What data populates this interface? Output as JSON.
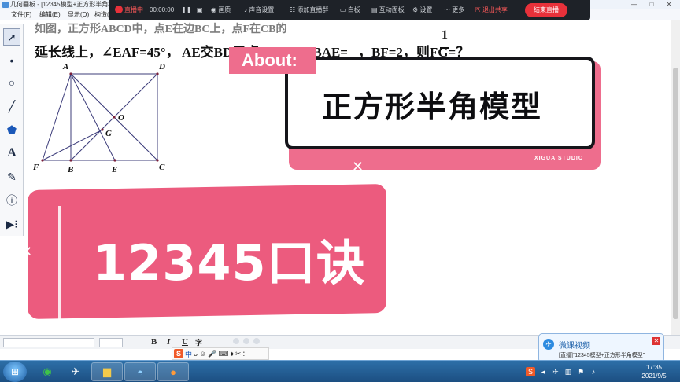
{
  "window": {
    "title": "几何画板 - [12345模型+正方形半角模",
    "controls": [
      "—",
      "□",
      "✕"
    ]
  },
  "menu": {
    "items": [
      "文件(F)",
      "编辑(E)",
      "显示(D)",
      "构造("
    ]
  },
  "livebar": {
    "status": "直播中",
    "timer": "00:00:00",
    "buttons": [
      "画质",
      "声音设置",
      "添加直播群",
      "白板",
      "互动面板",
      "设置",
      "更多"
    ],
    "share": "退出共享",
    "end": "结束直播"
  },
  "toolbox": {
    "tools": [
      "arrow-select",
      "point",
      "circle",
      "line",
      "polygon",
      "text",
      "marker",
      "info",
      "custom"
    ]
  },
  "problem": {
    "line1": "延长线上，∠EAF=45°，  AE交BD于点G，tan∠BAE=",
    "frac_num": "1",
    "line1b": "，BF=2，则FG=？",
    "top_partial": "如图，正方形ABCD中，点E在边BC上，点F在CB的"
  },
  "figure": {
    "labels": [
      "A",
      "D",
      "O",
      "G",
      "F",
      "B",
      "E",
      "C"
    ]
  },
  "about_card": {
    "tag": "About:",
    "title": "正方形半角模型",
    "studio": "XIGUA STUDIO"
  },
  "mnemonic": {
    "text": "12345口诀"
  },
  "formatbar": {
    "buttons": [
      "B",
      "I",
      "U",
      "字"
    ]
  },
  "notification": {
    "title": "微课视频",
    "body": "[直播]“12345模型+正方形半角模型”",
    "close": "✕"
  },
  "ime": {
    "logo": "S",
    "mode": "中"
  },
  "taskbar": {
    "clock_time": "17:35",
    "clock_date": "2021/9/5"
  },
  "colors": {
    "accent_pink": "#ec5b7e",
    "live_red": "#e8313a"
  }
}
